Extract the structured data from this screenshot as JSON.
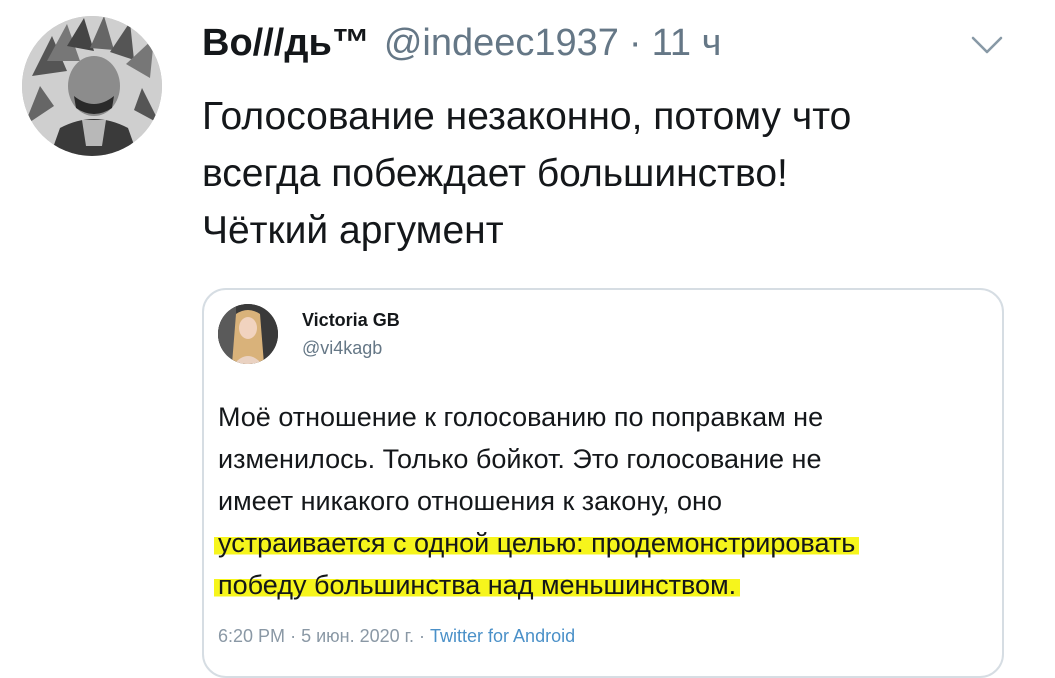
{
  "tweet": {
    "display_name": "Во///дь™",
    "handle": "@indeec1937",
    "separator": "·",
    "time": "11 ч",
    "text_lines": [
      "Голосование незаконно, потому что",
      "всегда побеждает большинство!",
      "Чёткий аргумент"
    ]
  },
  "icons": {
    "avatar": "avatar-photo",
    "menu": "chevron-down-icon"
  },
  "quoted": {
    "display_name": "Victoria GB",
    "handle": "@vi4kagb",
    "text_lines": [
      "Моё отношение к голосованию по поправкам не",
      "изменилось. Только бойкот. Это голосование не",
      "имеет никакого отношения к закону, оно",
      "устраивается с одной целью: продемонстрировать",
      "победу большинства над меньшинством."
    ],
    "highlighted_lines": [
      3,
      4
    ],
    "footer": {
      "time": "6:20 PM",
      "sep1": "·",
      "date": "5 июн. 2020 г.",
      "sep2": "·",
      "source": "Twitter for Android"
    }
  },
  "colors": {
    "text": "#14171a",
    "muted": "#657786",
    "border": "#d6dde3",
    "highlight": "#f6f51c",
    "link": "#4a90c8"
  }
}
